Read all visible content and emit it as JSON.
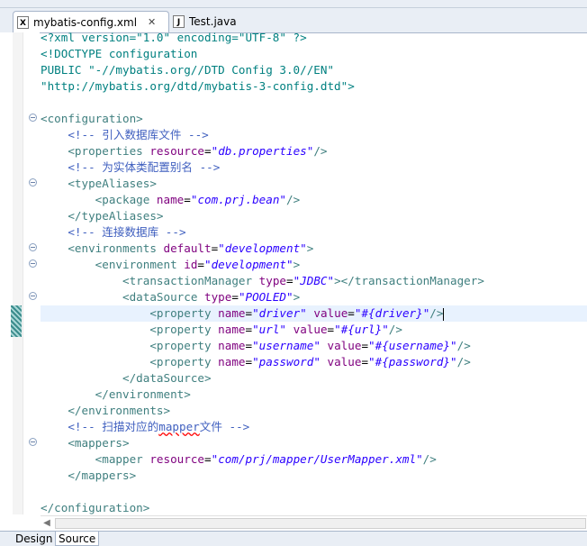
{
  "tabs": [
    {
      "label": "mybatis-config.xml",
      "icon": "xml-file-icon",
      "glyph": "X",
      "active": true,
      "dirty_marker": "✕"
    },
    {
      "label": "Test.java",
      "icon": "java-file-icon",
      "glyph": "J",
      "active": false
    }
  ],
  "editor": {
    "lines": [
      [
        {
          "c": "pi",
          "t": "<?xml version=\"1.0\" encoding=\"UTF-8\" ?>"
        }
      ],
      [
        {
          "c": "dt",
          "t": "<!DOCTYPE configuration"
        }
      ],
      [
        {
          "c": "dt",
          "t": "PUBLIC \"-//mybatis.org//DTD Config 3.0//EN\""
        }
      ],
      [
        {
          "c": "dt",
          "t": "\"http://mybatis.org/dtd/mybatis-3-config.dtd\">"
        }
      ],
      [],
      [
        {
          "c": "tg",
          "t": "<configuration>"
        }
      ],
      [
        {
          "c": "",
          "t": "    "
        },
        {
          "c": "cm",
          "t": "<!-- 引入数据库文件 -->"
        }
      ],
      [
        {
          "c": "",
          "t": "    "
        },
        {
          "c": "tg",
          "t": "<properties "
        },
        {
          "c": "an",
          "t": "resource"
        },
        {
          "c": "",
          "t": "="
        },
        {
          "c": "av",
          "t": "\"db.properties\""
        },
        {
          "c": "tg",
          "t": "/>"
        }
      ],
      [
        {
          "c": "",
          "t": "    "
        },
        {
          "c": "cm",
          "t": "<!-- 为实体类配置别名 -->"
        }
      ],
      [
        {
          "c": "",
          "t": "    "
        },
        {
          "c": "tg",
          "t": "<typeAliases>"
        }
      ],
      [
        {
          "c": "",
          "t": "        "
        },
        {
          "c": "tg",
          "t": "<package "
        },
        {
          "c": "an",
          "t": "name"
        },
        {
          "c": "",
          "t": "="
        },
        {
          "c": "av",
          "t": "\"com.prj.bean\""
        },
        {
          "c": "tg",
          "t": "/>"
        }
      ],
      [
        {
          "c": "",
          "t": "    "
        },
        {
          "c": "tg",
          "t": "</typeAliases>"
        }
      ],
      [
        {
          "c": "",
          "t": "    "
        },
        {
          "c": "cm",
          "t": "<!-- 连接数据库 -->"
        }
      ],
      [
        {
          "c": "",
          "t": "    "
        },
        {
          "c": "tg",
          "t": "<environments "
        },
        {
          "c": "an",
          "t": "default"
        },
        {
          "c": "",
          "t": "="
        },
        {
          "c": "av",
          "t": "\"development\""
        },
        {
          "c": "tg",
          "t": ">"
        }
      ],
      [
        {
          "c": "",
          "t": "        "
        },
        {
          "c": "tg",
          "t": "<environment "
        },
        {
          "c": "an",
          "t": "id"
        },
        {
          "c": "",
          "t": "="
        },
        {
          "c": "av",
          "t": "\"development\""
        },
        {
          "c": "tg",
          "t": ">"
        }
      ],
      [
        {
          "c": "",
          "t": "            "
        },
        {
          "c": "tg",
          "t": "<transactionManager "
        },
        {
          "c": "an",
          "t": "type"
        },
        {
          "c": "",
          "t": "="
        },
        {
          "c": "av",
          "t": "\"JDBC\""
        },
        {
          "c": "tg",
          "t": "></transactionManager>"
        }
      ],
      [
        {
          "c": "",
          "t": "            "
        },
        {
          "c": "tg",
          "t": "<dataSource "
        },
        {
          "c": "an",
          "t": "type"
        },
        {
          "c": "",
          "t": "="
        },
        {
          "c": "av",
          "t": "\"POOLED\""
        },
        {
          "c": "tg",
          "t": ">"
        }
      ],
      [
        {
          "c": "",
          "t": "                "
        },
        {
          "c": "tg",
          "t": "<property "
        },
        {
          "c": "an",
          "t": "name"
        },
        {
          "c": "",
          "t": "="
        },
        {
          "c": "av",
          "t": "\"driver\""
        },
        {
          "c": "",
          "t": " "
        },
        {
          "c": "an",
          "t": "value"
        },
        {
          "c": "",
          "t": "="
        },
        {
          "c": "av",
          "t": "\"#{driver}\""
        },
        {
          "c": "tg",
          "t": "/>"
        },
        {
          "c": "caret",
          "t": ""
        }
      ],
      [
        {
          "c": "",
          "t": "                "
        },
        {
          "c": "tg",
          "t": "<property "
        },
        {
          "c": "an",
          "t": "name"
        },
        {
          "c": "",
          "t": "="
        },
        {
          "c": "av",
          "t": "\"url\""
        },
        {
          "c": "",
          "t": " "
        },
        {
          "c": "an",
          "t": "value"
        },
        {
          "c": "",
          "t": "="
        },
        {
          "c": "av",
          "t": "\"#{url}\""
        },
        {
          "c": "tg",
          "t": "/>"
        }
      ],
      [
        {
          "c": "",
          "t": "                "
        },
        {
          "c": "tg",
          "t": "<property "
        },
        {
          "c": "an",
          "t": "name"
        },
        {
          "c": "",
          "t": "="
        },
        {
          "c": "av",
          "t": "\"username\""
        },
        {
          "c": "",
          "t": " "
        },
        {
          "c": "an",
          "t": "value"
        },
        {
          "c": "",
          "t": "="
        },
        {
          "c": "av",
          "t": "\"#{username}\""
        },
        {
          "c": "tg",
          "t": "/>"
        }
      ],
      [
        {
          "c": "",
          "t": "                "
        },
        {
          "c": "tg",
          "t": "<property "
        },
        {
          "c": "an",
          "t": "name"
        },
        {
          "c": "",
          "t": "="
        },
        {
          "c": "av",
          "t": "\"password\""
        },
        {
          "c": "",
          "t": " "
        },
        {
          "c": "an",
          "t": "value"
        },
        {
          "c": "",
          "t": "="
        },
        {
          "c": "av",
          "t": "\"#{password}\""
        },
        {
          "c": "tg",
          "t": "/>"
        }
      ],
      [
        {
          "c": "",
          "t": "            "
        },
        {
          "c": "tg",
          "t": "</dataSource>"
        }
      ],
      [
        {
          "c": "",
          "t": "        "
        },
        {
          "c": "tg",
          "t": "</environment>"
        }
      ],
      [
        {
          "c": "",
          "t": "    "
        },
        {
          "c": "tg",
          "t": "</environments>"
        }
      ],
      [
        {
          "c": "",
          "t": "    "
        },
        {
          "c": "cm",
          "t": "<!-- 扫描对应的"
        },
        {
          "c": "cm sq",
          "t": "mapper"
        },
        {
          "c": "cm",
          "t": "文件 -->"
        }
      ],
      [
        {
          "c": "",
          "t": "    "
        },
        {
          "c": "tg",
          "t": "<mappers>"
        }
      ],
      [
        {
          "c": "",
          "t": "        "
        },
        {
          "c": "tg",
          "t": "<mapper "
        },
        {
          "c": "an",
          "t": "resource"
        },
        {
          "c": "",
          "t": "="
        },
        {
          "c": "av",
          "t": "\"com/prj/mapper/UserMapper.xml\""
        },
        {
          "c": "tg",
          "t": "/>"
        }
      ],
      [
        {
          "c": "",
          "t": "    "
        },
        {
          "c": "tg",
          "t": "</mappers>"
        }
      ],
      [],
      [
        {
          "c": "tg",
          "t": "</configuration>"
        }
      ]
    ]
  },
  "bottom_tabs": [
    {
      "label": "Design",
      "selected": false
    },
    {
      "label": "Source",
      "selected": true
    }
  ]
}
